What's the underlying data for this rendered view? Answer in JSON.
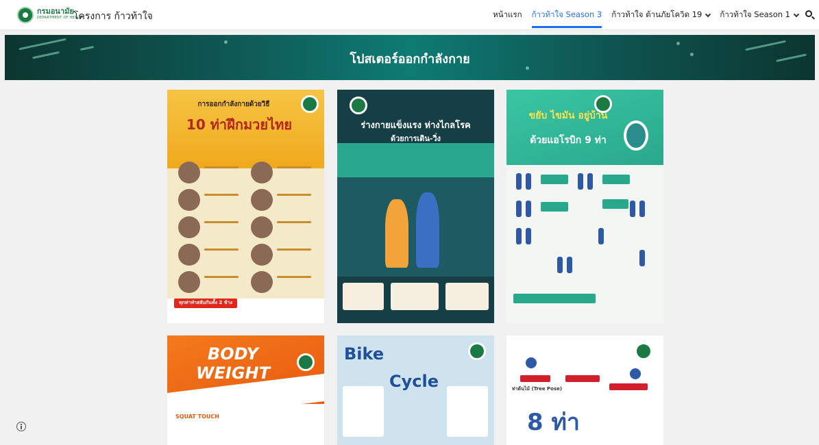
{
  "header": {
    "logo_icon": "department-of-health-emblem",
    "dept_name_th": "กรมอนามัย",
    "dept_name_en": "DEPARTMENT OF HEALTH",
    "site_title": "โครงการ ก้าวท้าใจ"
  },
  "nav": {
    "items": [
      {
        "label": "หน้าแรก",
        "active": false,
        "has_dropdown": false
      },
      {
        "label": "ก้าวท้าใจ Season 3",
        "active": true,
        "has_dropdown": false
      },
      {
        "label": "ก้าวท้าใจ ต้านภัยโควิด 19",
        "active": false,
        "has_dropdown": true
      },
      {
        "label": "ก้าวท้าใจ Season 1",
        "active": false,
        "has_dropdown": true
      }
    ],
    "search_icon": "search-icon",
    "accent_color": "#1f6feb"
  },
  "banner": {
    "title": "โปสเตอร์ออกกำลังกาย"
  },
  "posters": [
    {
      "title_1": "การออกกำลังกายด้วยวิธี",
      "title_2": "10 ท่าฝึกมวยไทย",
      "footer": "ทุกท่าทำสลับกันทั้ง 2 ข้าง"
    },
    {
      "title_1": "ร่างกายแข็งแรง ห่างไกลโรค",
      "title_2": "ด้วยการเดิน-วิ่ง"
    },
    {
      "title_1": "ขยับ ไขมัน อยู่บ้าน",
      "title_2": "ด้วยแอโรบิก 9 ท่า"
    },
    {
      "title_1": "BODY WEIGHT",
      "title_2": "SQUAT TOUCH"
    },
    {
      "title_1": "Bike",
      "title_2": "Cycle"
    },
    {
      "title_1": "ท่าต้นไม้ (Tree Pose)",
      "title_2": "8 ท่า"
    }
  ],
  "info_icon": "info-icon"
}
